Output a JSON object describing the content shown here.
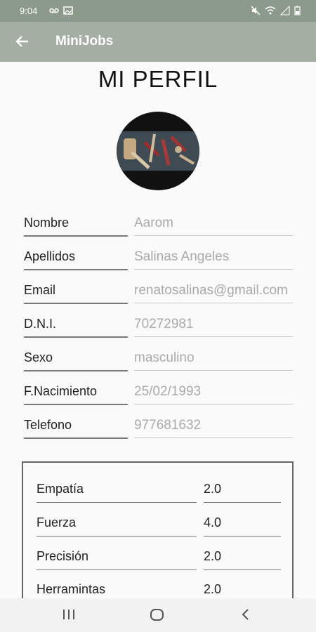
{
  "status_bar": {
    "time": "9:04",
    "left_icons": [
      "voicemail-icon",
      "image-icon"
    ],
    "right_icons": [
      "mute-icon",
      "wifi-icon",
      "signal-icon",
      "battery-icon"
    ]
  },
  "app_bar": {
    "title": "MiniJobs",
    "back_icon": "arrow-left-icon",
    "background": "#a4aea2"
  },
  "page": {
    "title": "MI PERFIL"
  },
  "profile_fields": [
    {
      "label": "Nombre",
      "value": "Aarom"
    },
    {
      "label": "Apellidos",
      "value": "Salinas Angeles"
    },
    {
      "label": "Email",
      "value": "renatosalinas@gmail.com"
    },
    {
      "label": "D.N.I.",
      "value": "70272981"
    },
    {
      "label": "Sexo",
      "value": "masculino"
    },
    {
      "label": "F.Nacimiento",
      "value": "25/02/1993"
    },
    {
      "label": "Telefono",
      "value": "977681632"
    }
  ],
  "skills": [
    {
      "label": "Empatía",
      "value": "2.0"
    },
    {
      "label": "Fuerza",
      "value": "4.0"
    },
    {
      "label": "Precisión",
      "value": "2.0"
    },
    {
      "label": "Herramintas",
      "value": "2.0"
    }
  ],
  "nav_bar": {
    "buttons": [
      "recent-apps-icon",
      "home-icon",
      "back-icon"
    ]
  }
}
